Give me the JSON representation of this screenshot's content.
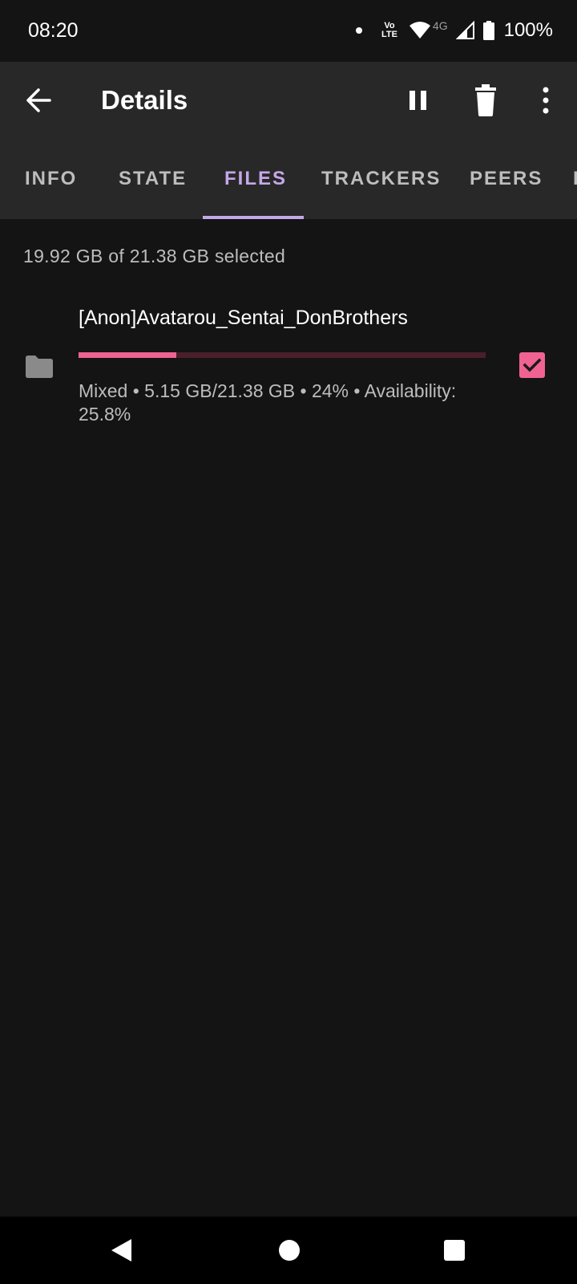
{
  "status_bar": {
    "time": "08:20",
    "volte_top": "Vo",
    "volte_bottom": "LTE",
    "network": "4G",
    "battery": "100%"
  },
  "app_bar": {
    "title": "Details",
    "icons": [
      "back-arrow-icon",
      "pause-icon",
      "delete-icon",
      "more-vert-icon"
    ]
  },
  "tabs": [
    {
      "label": "INFO",
      "active": false
    },
    {
      "label": "STATE",
      "active": false
    },
    {
      "label": "FILES",
      "active": true
    },
    {
      "label": "TRACKERS",
      "active": false
    },
    {
      "label": "PEERS",
      "active": false
    }
  ],
  "files": {
    "summary": "19.92 GB of 21.38 GB selected",
    "items": [
      {
        "name": "[Anon]Avatarou_Sentai_DonBrothers",
        "meta": "Mixed • 5.15 GB/21.38 GB • 24% • Availability: 25.8%",
        "progress": 0.24,
        "selected": true,
        "icon": "folder-icon"
      }
    ]
  },
  "colors": {
    "accent": "#c5a8e8",
    "progress": "#f06292",
    "progress_track": "#4a1f2c",
    "background": "#141414",
    "app_bar": "#282828"
  }
}
